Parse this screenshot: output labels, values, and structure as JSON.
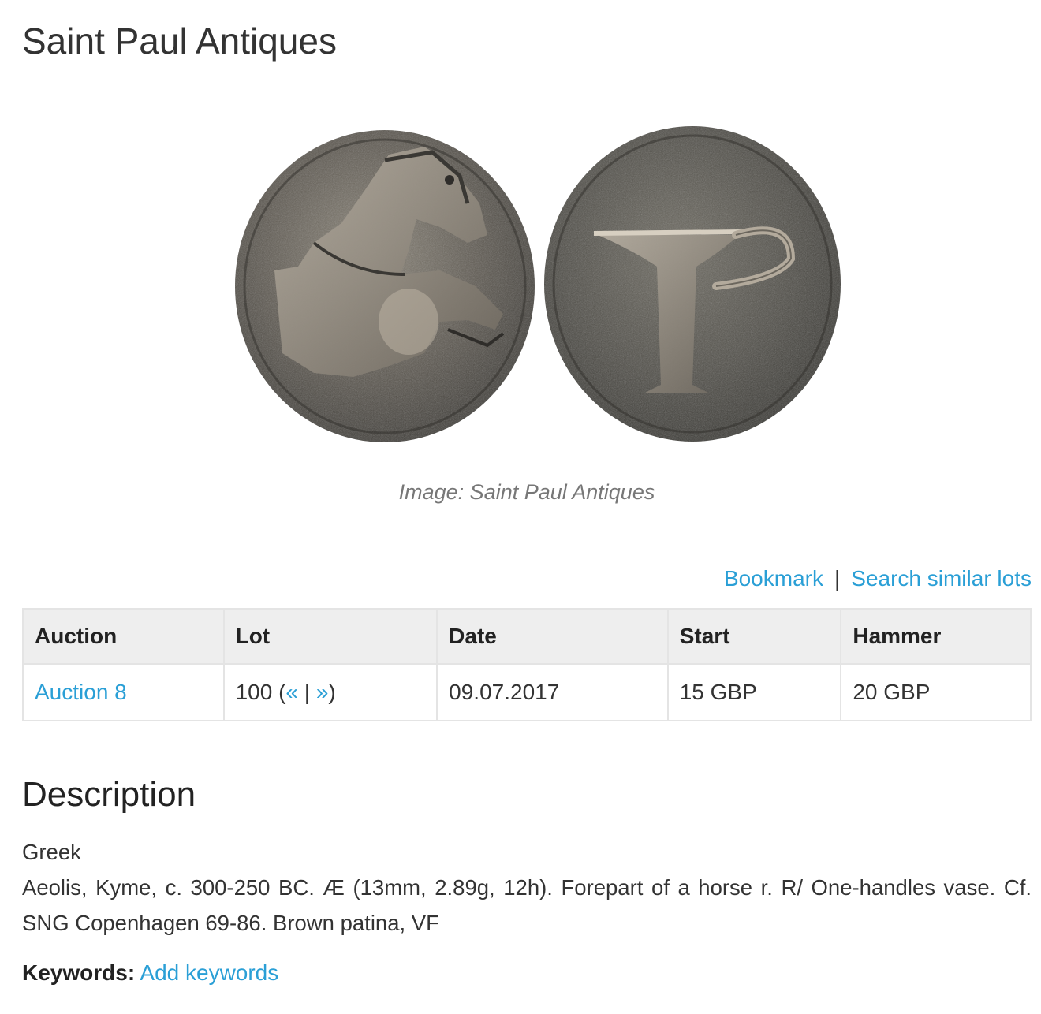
{
  "header": {
    "title": "Saint Paul Antiques"
  },
  "image": {
    "caption": "Image: Saint Paul Antiques",
    "obverse": "coin-obverse-horse",
    "reverse": "coin-reverse-vase"
  },
  "actions": {
    "bookmark": "Bookmark",
    "separator": "|",
    "search_similar": "Search similar lots"
  },
  "lot_table": {
    "headers": [
      "Auction",
      "Lot",
      "Date",
      "Start",
      "Hammer"
    ],
    "row": {
      "auction": "Auction 8",
      "lot_number": "100",
      "lot_open": " (",
      "prev": "«",
      "lot_sep": " | ",
      "next": "»",
      "lot_close": ")",
      "date": "09.07.2017",
      "start": "15 GBP",
      "hammer": "20 GBP"
    }
  },
  "description": {
    "heading": "Description",
    "category": "Greek",
    "text": "Aeolis, Kyme, c. 300-250 BC. Æ (13mm, 2.89g, 12h). Forepart of a horse r. R/ One-handles vase. Cf. SNG Copenhagen 69-86. Brown patina, VF"
  },
  "keywords": {
    "label": "Keywords:",
    "add_link": "Add keywords"
  },
  "colors": {
    "link": "#2a9fd6",
    "text": "#333333",
    "table_header_bg": "#eeeeee",
    "table_border": "#e4e4e4",
    "caption": "#777777"
  }
}
